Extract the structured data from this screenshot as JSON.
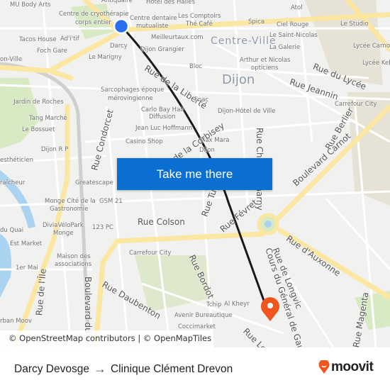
{
  "map": {
    "labels": [
      "MU Body Arts",
      "Antiquaire",
      "Hôtel des Halles",
      "Centre de cryothérapie",
      "corps entier",
      "Centre dentaire",
      "mutualiste",
      "Les Comptoirs",
      "Thé Café",
      "Atol",
      "Spica",
      "Ciel Rouge",
      "Le Saint-Nicolas",
      "Centre-Ville",
      "La Galerie",
      "Le Studio",
      "Lycée Carnot",
      "Lycée Kebir",
      "Tacos House",
      "Ad'i'tif",
      "Foch Gare",
      "Darcy",
      "Meilleurtaux.com",
      "Dijon Grangier",
      "Le Marigny",
      "on-Ville",
      "Bloc",
      "Arthur et Nicolas",
      "opticiens",
      "Rue du Lycée",
      "Rue de la Liberté",
      "Dijon",
      "Rue Jeannin",
      "Sarcophages époque",
      "mérovingienne",
      "Fnac",
      "Carrefour City",
      "Jardin de Roches",
      "Dijon-Hôtel de Ville",
      "Carlo Bay Hair",
      "Diffusion",
      "Jean Luc Hoffmann",
      "Tang Marché",
      "Le Bossuet",
      "Rue Condorcet",
      "Casino Shop",
      "Max Mara",
      "Dijon",
      "Rue Chabot-Charny",
      "Rue Berlier",
      "Boulevard Carnot",
      "Dijon R P",
      "esthéticien",
      "raîcheur",
      "Greatescape",
      "Monge Cité de la",
      "Gastronomie",
      "GSM 21",
      "DiviaVéloPark",
      "Monge",
      "123 PC",
      "Rue Colson",
      "Rue Turgot",
      "Rue Févret",
      "du Quai",
      "Est Market",
      "Rue d'Auxonne",
      "Maison des",
      "associations",
      "Carrefour City",
      "Rue Bordot",
      "Cours du Général de Gaulle",
      "Rue de Longvic",
      "1er Mai",
      "Rue de l'Île",
      "Boulevard du",
      "Rue Daubenton",
      "Tchip",
      "Al Kheyr",
      "Avenir Bureautique",
      "Coccimarket",
      "Rue Le M",
      "Rue Magenta",
      "rban Moov",
      "Rue de la Corbisey"
    ],
    "colors": {
      "route": "#1a1a1a",
      "origin": "#2a6ef0",
      "destination": "#f0561d",
      "major_road": "#fbe6a2",
      "park": "#d7eac4",
      "water": "#a9d3f0",
      "button": "#0a6fd0"
    },
    "icons": {
      "origin": "blue-dot-icon",
      "destination": "map-pin-icon"
    }
  },
  "cta": {
    "label": "Take me there"
  },
  "attribution": "© OpenStreetMap contributors | © OpenMapTiles",
  "footer": {
    "origin": "Darcy Devosge",
    "arrow": "→",
    "destination": "Clinique Clément Drevon",
    "logo": "moovit"
  }
}
